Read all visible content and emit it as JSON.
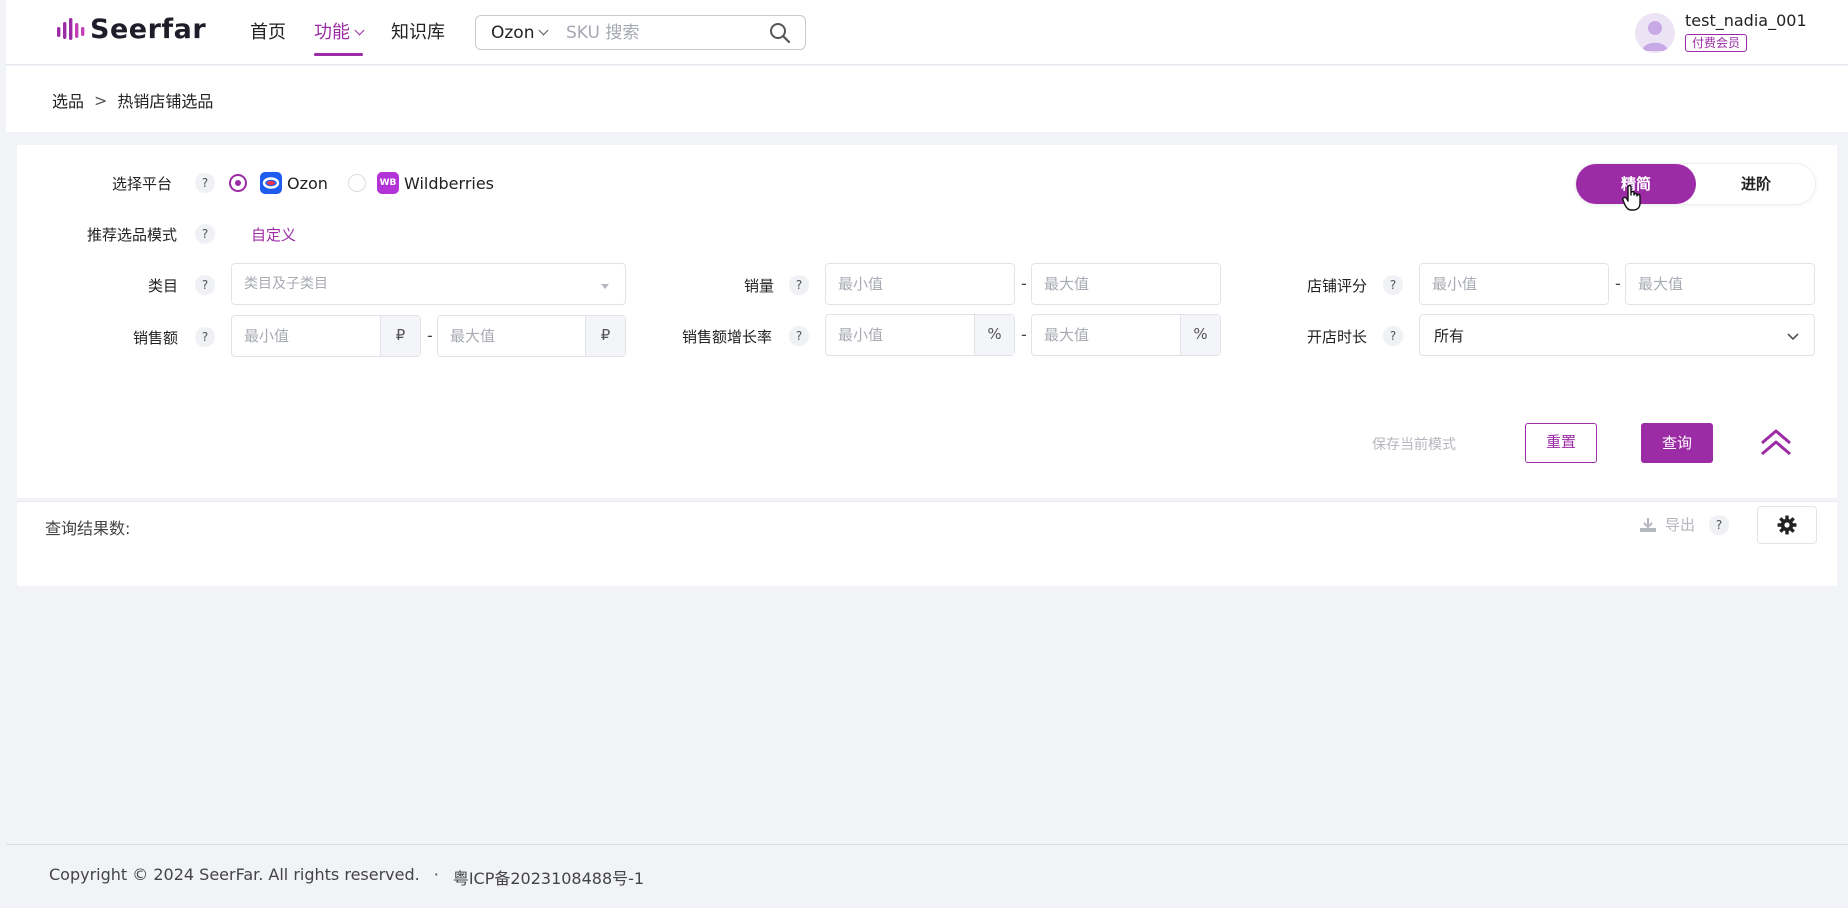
{
  "header": {
    "logo_text": "Seerfar",
    "nav": [
      {
        "label": "首页",
        "active": false,
        "dropdown": false
      },
      {
        "label": "功能",
        "active": true,
        "dropdown": true
      },
      {
        "label": "知识库",
        "active": false,
        "dropdown": false
      }
    ],
    "search": {
      "platform": "Ozon",
      "placeholder": "SKU 搜索",
      "value": ""
    },
    "user": {
      "name": "test_nadia_001",
      "badge": "付费会员"
    }
  },
  "breadcrumb": {
    "parent": "选品",
    "separator": ">",
    "current": "热销店铺选品"
  },
  "filters": {
    "platform_label": "选择平台",
    "platforms": [
      {
        "name": "Ozon",
        "selected": true,
        "logo_color": "#1e5cf0"
      },
      {
        "name": "Wildberries",
        "selected": false,
        "logo_color": "#b233d6",
        "logo_text": "WB"
      }
    ],
    "mode_label": "推荐选品模式",
    "mode_value": "自定义",
    "toggle": {
      "simple": "精简",
      "advanced": "进阶",
      "active": "simple"
    },
    "help_mark": "?",
    "category": {
      "label": "类目",
      "placeholder": "类目及子类目"
    },
    "sales_volume": {
      "label": "销量",
      "min_placeholder": "最小值",
      "max_placeholder": "最大值"
    },
    "shop_rating": {
      "label": "店铺评分",
      "min_placeholder": "最小值",
      "max_placeholder": "最大值"
    },
    "sales_amount": {
      "label": "销售额",
      "min_placeholder": "最小值",
      "max_placeholder": "最大值",
      "unit": "₽"
    },
    "growth_rate": {
      "label": "销售额增长率",
      "min_placeholder": "最小值",
      "max_placeholder": "最大值",
      "unit": "%"
    },
    "shop_age": {
      "label": "开店时长",
      "value": "所有"
    },
    "range_separator": "-",
    "actions": {
      "save_mode": "保存当前模式",
      "reset": "重置",
      "query": "查询"
    }
  },
  "results": {
    "count_label": "查询结果数:",
    "export_label": "导出"
  },
  "footer": {
    "copyright": "Copyright © 2024 SeerFar. All rights reserved.",
    "separator": "·",
    "icp": "粤ICP备2023108488号-1"
  },
  "colors": {
    "accent": "#9c2ca5",
    "background": "#f1f3f7",
    "border": "#e2e3e8"
  }
}
